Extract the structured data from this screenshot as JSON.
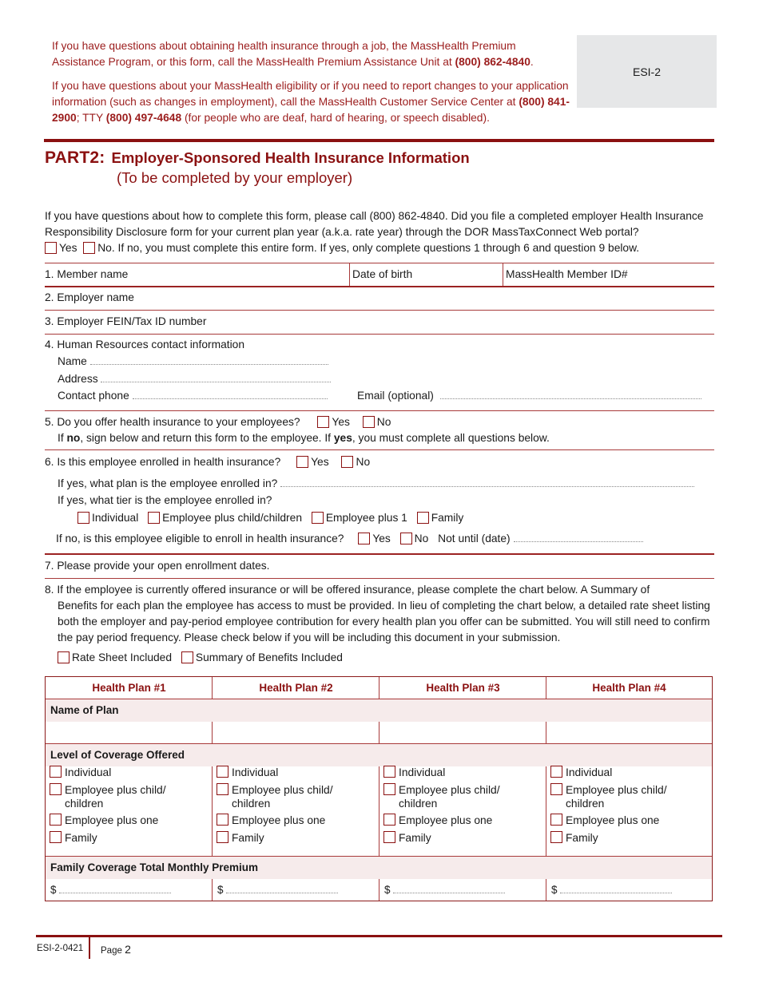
{
  "header": {
    "info_para1": {
      "text": "If you have questions about obtaining health insurance through a job, the MassHealth Premium Assistance Program, or this form, call the MassHealth Premium Assistance Unit at ",
      "phone": "(800) 862-4840",
      "end": "."
    },
    "info_para2": {
      "text": "If you have questions about your MassHealth eligibility or if you need to report changes to your application information (such as changes in employment), call the MassHealth Customer Service Center at ",
      "phone1": "(800) 841-2900",
      "mid": "; TTY ",
      "phone2": "(800) 497-4648",
      "end": " (for people who are deaf, hard of hearing, or speech disabled)."
    },
    "form_id_box": "ESI-2"
  },
  "part": {
    "label": "PART2:",
    "title": "Employer-Sponsored Health Insurance Information",
    "subtitle": "(To be completed by your employer)"
  },
  "intro": {
    "text": "If you have questions about how to complete this form, please call (800) 862-4840. Did you file a completed employer Health Insurance Responsibility Disclosure form for your current plan year (a.k.a. rate year) through the DOR MassTaxConnect Web portal?",
    "yes_label": "Yes",
    "no_label": "No. If no, you must complete this entire form. If yes, only complete questions 1 through 6 and question 9 below."
  },
  "questions": {
    "q1": {
      "member_name": "1. Member name",
      "dob": "Date of birth",
      "member_id": "MassHealth Member ID#"
    },
    "q2": "2. Employer name",
    "q3": "3. Employer FEIN/Tax ID number",
    "q4": {
      "title": "4. Human Resources contact information",
      "name": "Name",
      "address": "Address",
      "phone": "Contact phone",
      "email": "Email (optional)"
    },
    "q5": {
      "title": "5. Do you offer health insurance to your employees?",
      "yes": "Yes",
      "no": "No",
      "note_pre": "If ",
      "note_no": "no",
      "note_mid": ", sign below and return this form to the employee. If ",
      "note_yes": "yes",
      "note_end": ", you must complete all questions below."
    },
    "q6": {
      "title": "6. Is this employee enrolled in health insurance?",
      "yes": "Yes",
      "no": "No",
      "plan_q": "If yes, what plan is the employee enrolled in?",
      "tier_q": "If yes, what tier is the employee enrolled in?",
      "tiers": [
        "Individual",
        "Employee plus child/children",
        "Employee plus 1",
        "Family"
      ],
      "eligible_q": "If no, is this employee eligible to enroll in health insurance?",
      "eligible_yes": "Yes",
      "eligible_no": "No",
      "not_until": "Not until (date)"
    },
    "q7": "7. Please provide your open enrollment dates.",
    "q8": {
      "text_first": "8. If the employee is currently offered insurance or will be offered insurance, please complete the chart below. A Summary of",
      "text_rest": "Benefits for each plan the employee has access to must be provided. In lieu of completing the chart below, a detailed rate sheet listing both the employer and pay-period employee contribution for every health plan you offer can be submitted. You will still need to confirm the pay period frequency. Please check below if you will be including this document in your submission.",
      "rate_sheet": "Rate Sheet Included",
      "summary": "Summary of Benefits Included"
    }
  },
  "plan_table": {
    "headers": [
      "Health Plan #1",
      "Health Plan #2",
      "Health Plan #3",
      "Health Plan #4"
    ],
    "name_of_plan": "Name of Plan",
    "level_of_coverage": "Level of Coverage Offered",
    "coverage_options": [
      "Individual",
      "Employee plus child/ children",
      "Employee plus one",
      "Family"
    ],
    "family_premium": "Family Coverage Total Monthly Premium",
    "currency": "$"
  },
  "footer": {
    "code": "ESI-2-0421",
    "page_label": "Page",
    "page_num": "2"
  },
  "colors": {
    "accent": "#8b1111",
    "band": "#f6ebeb",
    "box_gray": "#e6e7e8"
  }
}
